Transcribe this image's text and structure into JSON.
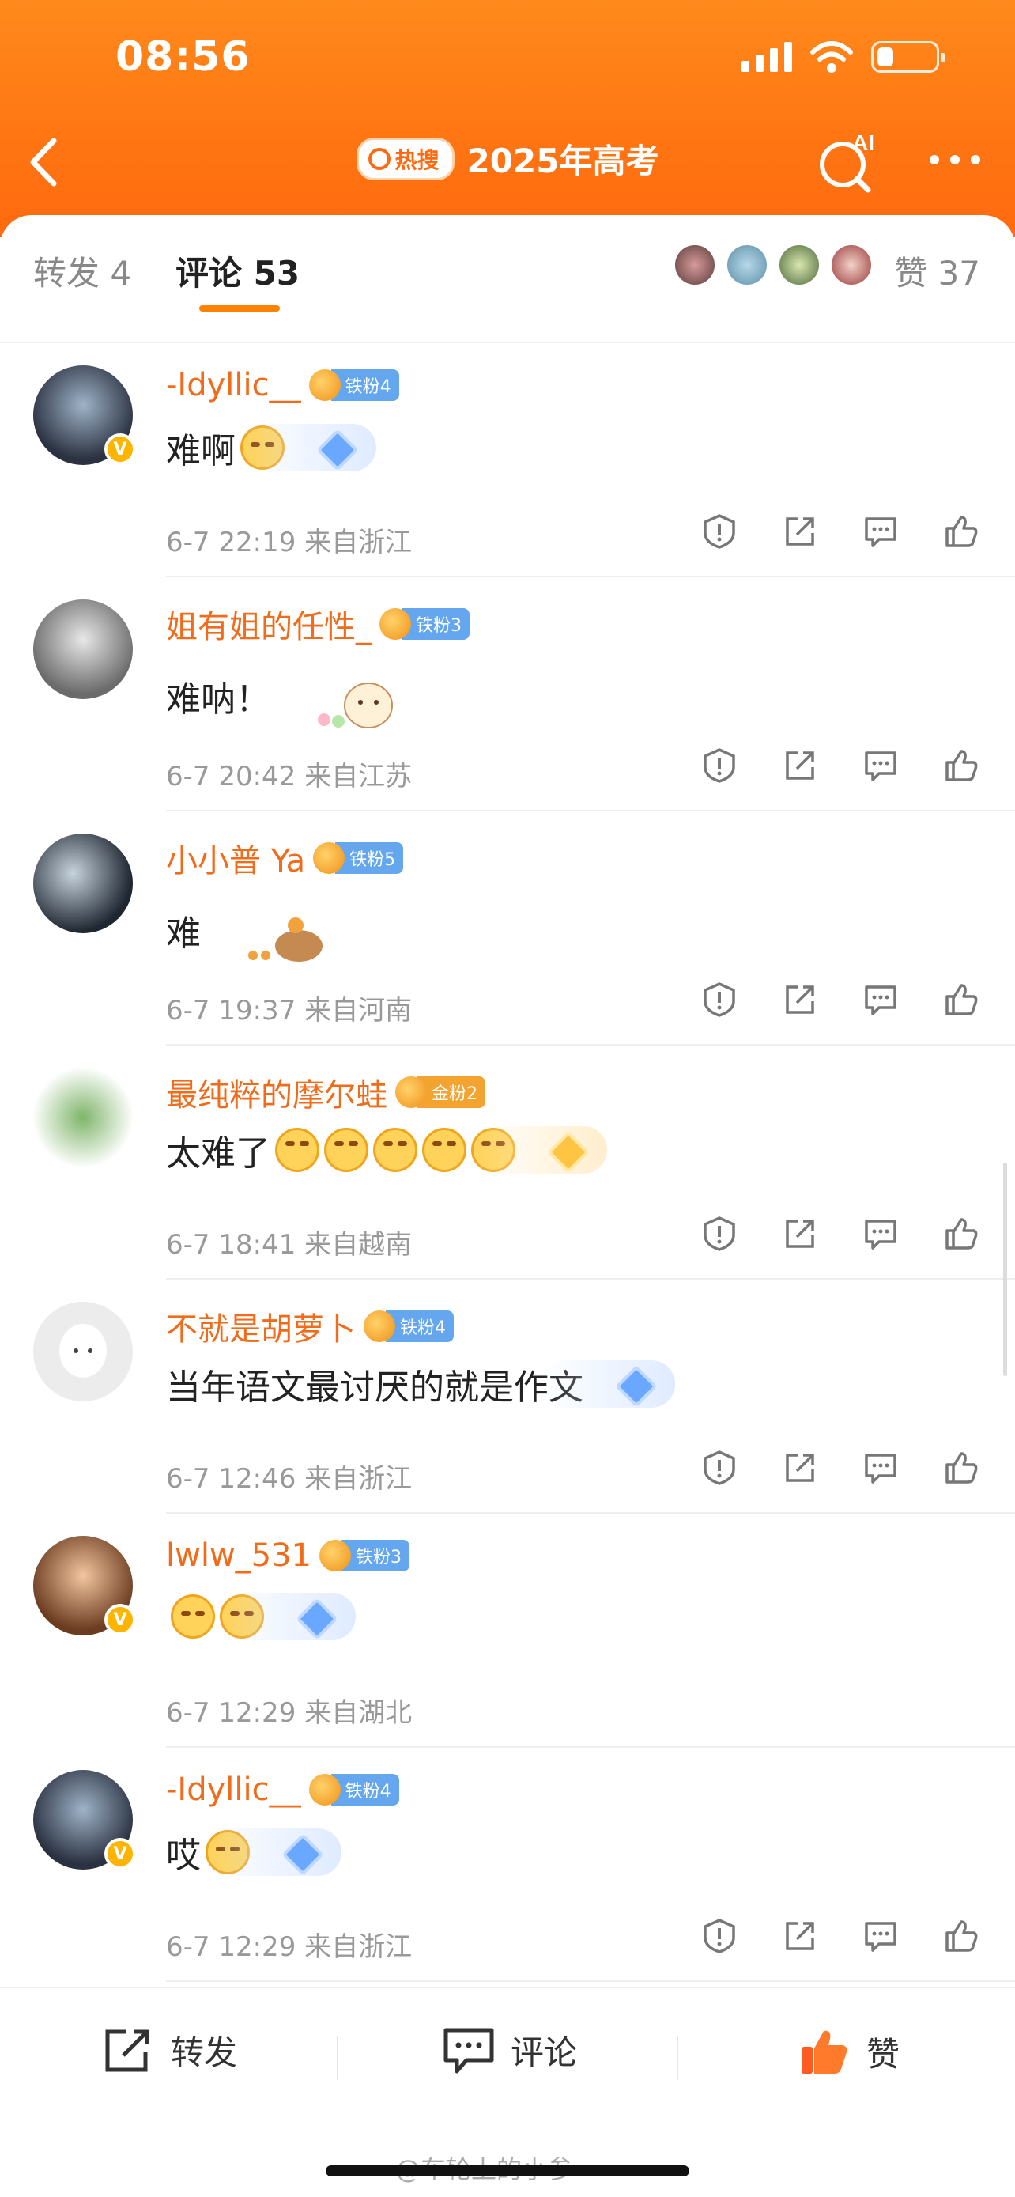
{
  "status_bar": {
    "time": "08:56"
  },
  "nav": {
    "hot_badge": "热搜",
    "title": "2025年高考",
    "ai_label": "AI"
  },
  "tabs": {
    "repost": "转发 4",
    "comments": "评论 53",
    "likes": "赞 37"
  },
  "comments": [
    {
      "name": "-Idyllic__",
      "fan_level": "铁粉4",
      "text": "难啊",
      "meta": "6-7 22:19  来自浙江",
      "verified": true
    },
    {
      "name": "姐有姐的任性_",
      "fan_level": "铁粉3",
      "text": "难呐！",
      "meta": "6-7 20:42  来自江苏",
      "verified": false
    },
    {
      "name": "小小普 Ya",
      "fan_level": "铁粉5",
      "text": "难",
      "meta": "6-7 19:37  来自河南",
      "verified": false
    },
    {
      "name": "最纯粹的摩尔蛙",
      "fan_level": "金粉2",
      "text": "太难了",
      "meta": "6-7 18:41  来自越南",
      "verified": false
    },
    {
      "name": "不就是胡萝卜",
      "fan_level": "铁粉4",
      "text": "当年语文最讨厌的就是作文",
      "meta": "6-7 12:46  来自浙江",
      "verified": false
    },
    {
      "name": "lwlw_531",
      "fan_level": "铁粉3",
      "text": "",
      "meta": "6-7 12:29  来自湖北",
      "verified": true
    },
    {
      "name": "-Idyllic__",
      "fan_level": "铁粉4",
      "text": "哎",
      "meta": "6-7 12:29  来自浙江",
      "verified": true
    }
  ],
  "bottom_bar": {
    "repost": "转发",
    "comment": "评论",
    "like": "赞"
  },
  "watermark": "@车轮上的小参",
  "colors": {
    "brand_orange": "#ff7512",
    "name_orange": "#f06b1a",
    "fan_blue": "#64a7ef",
    "fan_gold": "#f3a330"
  }
}
